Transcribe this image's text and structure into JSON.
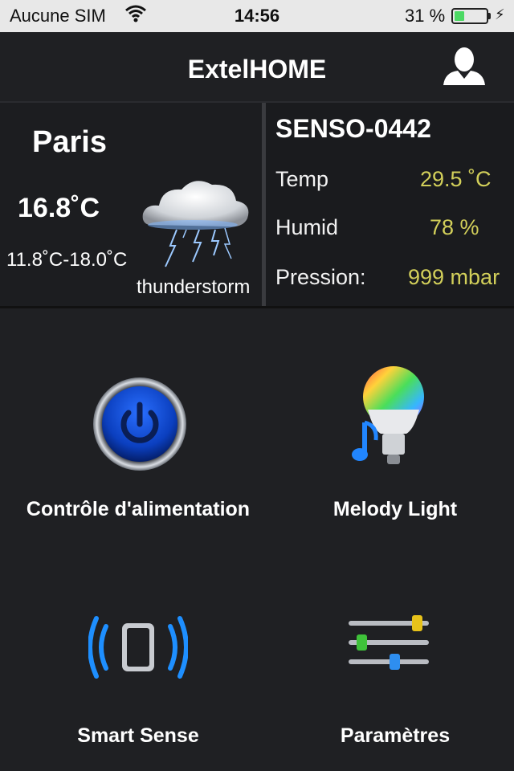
{
  "status_bar": {
    "carrier": "Aucune SIM",
    "time": "14:56",
    "battery_percent_label": "31 %",
    "battery_level": 0.31
  },
  "header": {
    "title": "ExtelHOME",
    "icon": "user-profile-icon"
  },
  "weather": {
    "city": "Paris",
    "temperature": "16.8˚C",
    "range": "11.8˚C-18.0˚C",
    "condition": "thunderstorm",
    "icon": "thunderstorm-cloud-icon"
  },
  "sensor": {
    "name": "SENSO-0442",
    "rows": [
      {
        "label": "Temp",
        "value": "29.5 ˚C"
      },
      {
        "label": "Humid",
        "value": "78 %"
      },
      {
        "label": "Pression:",
        "value": "999 mbar"
      }
    ],
    "value_color": "#d2cf5a"
  },
  "tiles": [
    {
      "label": "Contrôle d'alimentation",
      "icon": "power-button-icon"
    },
    {
      "label": "Melody Light",
      "icon": "music-bulb-icon"
    },
    {
      "label": "Smart Sense",
      "icon": "smart-sense-icon"
    },
    {
      "label": "Paramètres",
      "icon": "sliders-icon"
    }
  ]
}
